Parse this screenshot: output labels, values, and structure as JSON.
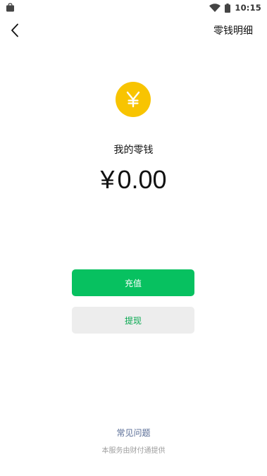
{
  "status_bar": {
    "time": "10:15",
    "icons": [
      "bag-icon",
      "wifi-icon",
      "battery-icon"
    ]
  },
  "nav": {
    "back_icon": "chevron-left-icon",
    "details_label": "零钱明细"
  },
  "wallet": {
    "icon": "yen-coin-icon",
    "coin_symbol": "¥",
    "label": "我的零钱",
    "currency_symbol": "¥",
    "balance": "0.00"
  },
  "actions": {
    "recharge_label": "充值",
    "withdraw_label": "提现"
  },
  "footer": {
    "faq_label": "常见问题",
    "provider_text": "本服务由财付通提供"
  },
  "colors": {
    "primary_green": "#07C160",
    "coin_yellow": "#F8C401",
    "link_blue": "#576B95",
    "secondary_button_bg": "#EDEDED"
  }
}
